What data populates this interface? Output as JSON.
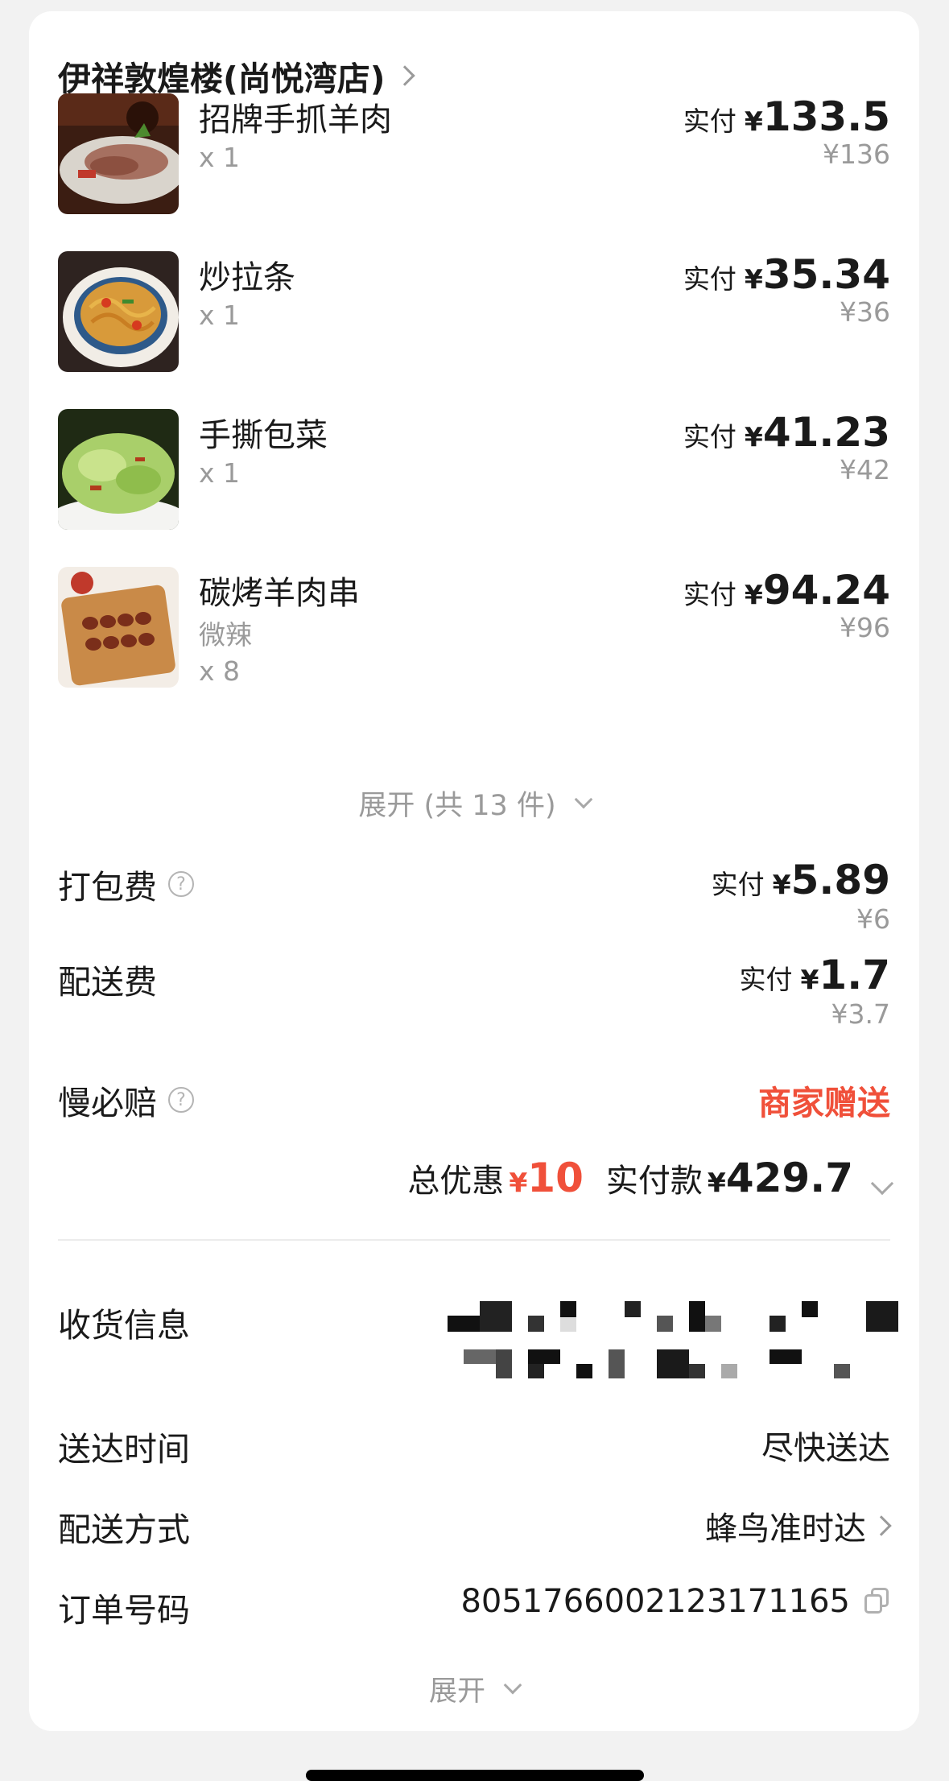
{
  "shop": {
    "name": "伊祥敦煌楼(尚悦湾店)"
  },
  "items": [
    {
      "name": "招牌手抓羊肉",
      "spec": "",
      "qty": "x 1",
      "paid_label": "实付",
      "currency": "¥",
      "paid": "133.5",
      "original": "¥136",
      "image": "lamb-dish"
    },
    {
      "name": "炒拉条",
      "spec": "",
      "qty": "x 1",
      "paid_label": "实付",
      "currency": "¥",
      "paid": "35.34",
      "original": "¥36",
      "image": "noodle-dish"
    },
    {
      "name": "手撕包菜",
      "spec": "",
      "qty": "x 1",
      "paid_label": "实付",
      "currency": "¥",
      "paid": "41.23",
      "original": "¥42",
      "image": "cabbage-dish"
    },
    {
      "name": "碳烤羊肉串",
      "spec": "微辣",
      "qty": "x 8",
      "paid_label": "实付",
      "currency": "¥",
      "paid": "94.24",
      "original": "¥96",
      "image": "skewer-dish"
    }
  ],
  "expand_items": "展开 (共 13 件)",
  "fees": {
    "packing": {
      "label": "打包费",
      "paid_label": "实付",
      "currency": "¥",
      "paid": "5.89",
      "original": "¥6"
    },
    "delivery": {
      "label": "配送费",
      "paid_label": "实付",
      "currency": "¥",
      "paid": "1.7",
      "original": "¥3.7"
    },
    "late_guarantee": {
      "label": "慢必赔",
      "value": "商家赠送"
    }
  },
  "summary": {
    "discount_label": "总优惠",
    "discount_currency": "¥",
    "discount": "10",
    "total_label": "实付款",
    "total_currency": "¥",
    "total": "429.7"
  },
  "info": {
    "address_label": "收货信息",
    "delivery_time_label": "送达时间",
    "delivery_time": "尽快送达",
    "delivery_method_label": "配送方式",
    "delivery_method": "蜂鸟准时达",
    "order_no_label": "订单号码",
    "order_no": "8051766002123171165"
  },
  "expand_bottom": "展开",
  "colors": {
    "accent": "#f0503a",
    "muted": "#9a9a9a",
    "text": "#1a1a1a"
  },
  "icons": {
    "help": "question-circle-icon",
    "copy": "copy-icon",
    "chevron_right": "chevron-right-icon",
    "chevron_down": "chevron-down-icon"
  }
}
